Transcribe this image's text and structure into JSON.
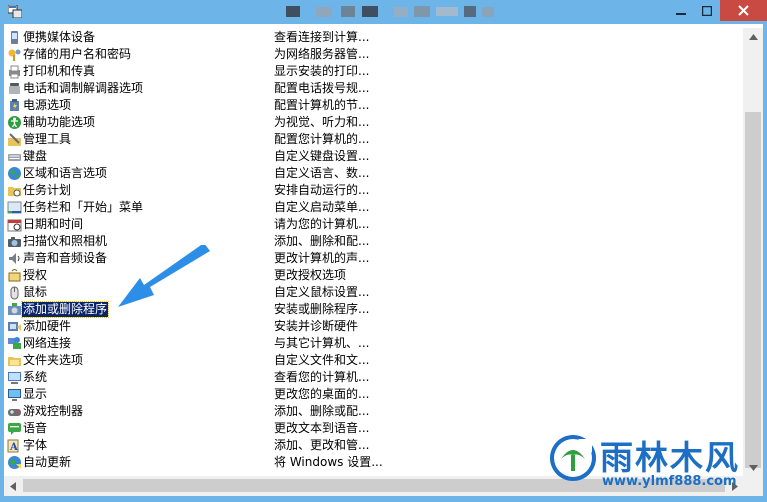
{
  "colors": {
    "titlebar": "#6db5e8",
    "close": "#c94a42",
    "selection": "#0a246a",
    "arrow": "#2d8ee8",
    "watermark": "#1c6fc4"
  },
  "window": {
    "minimize_glyph": "–",
    "maximize_glyph": "□",
    "close_glyph": "✕"
  },
  "items": [
    {
      "name": "便携媒体设备",
      "desc": "查看连接到计算...",
      "icon": "portable-device-icon"
    },
    {
      "name": "存储的用户名和密码",
      "desc": "为网络服务器管...",
      "icon": "key-icon"
    },
    {
      "name": "打印机和传真",
      "desc": "显示安装的打印...",
      "icon": "printer-icon"
    },
    {
      "name": "电话和调制解调器选项",
      "desc": "配置电话拨号规...",
      "icon": "phone-icon"
    },
    {
      "name": "电源选项",
      "desc": "配置计算机的节...",
      "icon": "power-icon"
    },
    {
      "name": "辅助功能选项",
      "desc": "为视觉、听力和...",
      "icon": "accessibility-icon"
    },
    {
      "name": "管理工具",
      "desc": "配置您计算机的...",
      "icon": "admin-tools-icon"
    },
    {
      "name": "键盘",
      "desc": "自定义键盘设置...",
      "icon": "keyboard-icon"
    },
    {
      "name": "区域和语言选项",
      "desc": "自定义语言、数...",
      "icon": "globe-icon"
    },
    {
      "name": "任务计划",
      "desc": "安排自动运行的...",
      "icon": "task-folder-icon"
    },
    {
      "name": "任务栏和「开始」菜单",
      "desc": "自定义启动菜单...",
      "icon": "taskbar-icon"
    },
    {
      "name": "日期和时间",
      "desc": "请为您的计算机...",
      "icon": "clock-icon"
    },
    {
      "name": "扫描仪和照相机",
      "desc": "添加、删除和配...",
      "icon": "camera-icon"
    },
    {
      "name": "声音和音频设备",
      "desc": "更改计算机的声...",
      "icon": "speaker-icon"
    },
    {
      "name": "授权",
      "desc": "更改授权选项",
      "icon": "license-icon"
    },
    {
      "name": "鼠标",
      "desc": "自定义鼠标设置...",
      "icon": "mouse-icon"
    },
    {
      "name": "添加或删除程序",
      "desc": "安装或删除程序...",
      "icon": "programs-icon"
    },
    {
      "name": "添加硬件",
      "desc": "安装并诊断硬件",
      "icon": "hardware-icon"
    },
    {
      "name": "网络连接",
      "desc": "与其它计算机、...",
      "icon": "network-icon"
    },
    {
      "name": "文件夹选项",
      "desc": "自定义文件和文...",
      "icon": "folder-icon"
    },
    {
      "name": "系统",
      "desc": "查看您的计算机...",
      "icon": "system-icon"
    },
    {
      "name": "显示",
      "desc": "更改您的桌面的...",
      "icon": "display-icon"
    },
    {
      "name": "游戏控制器",
      "desc": "添加、删除或配...",
      "icon": "gamepad-icon"
    },
    {
      "name": "语音",
      "desc": "更改文本到语音...",
      "icon": "speech-icon"
    },
    {
      "name": "字体",
      "desc": "添加、更改和管...",
      "icon": "font-icon"
    },
    {
      "name": "自动更新",
      "desc": "将 Windows 设置...",
      "icon": "update-icon"
    }
  ],
  "selected_index": 16,
  "watermark": {
    "title": "雨林木风",
    "url": "www.ylmf888.com"
  }
}
